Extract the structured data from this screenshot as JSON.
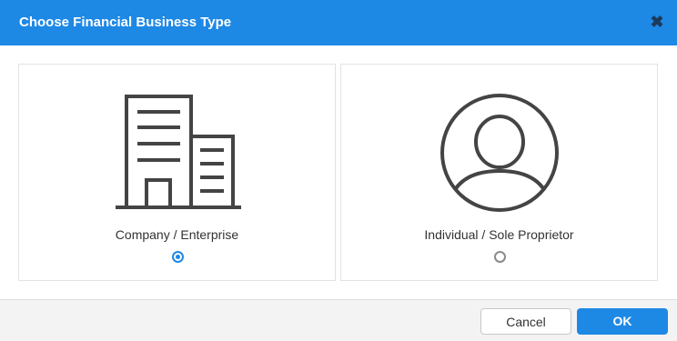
{
  "dialog": {
    "title": "Choose Financial Business Type",
    "close_icon": "close-icon",
    "options": [
      {
        "label": "Company / Enterprise",
        "icon": "building-icon",
        "selected": true
      },
      {
        "label": "Individual / Sole Proprietor",
        "icon": "user-avatar-icon",
        "selected": false
      }
    ],
    "cancel_label": "Cancel",
    "ok_label": "OK"
  },
  "colors": {
    "accent": "#1e88e5",
    "icon_stroke": "#444444"
  }
}
